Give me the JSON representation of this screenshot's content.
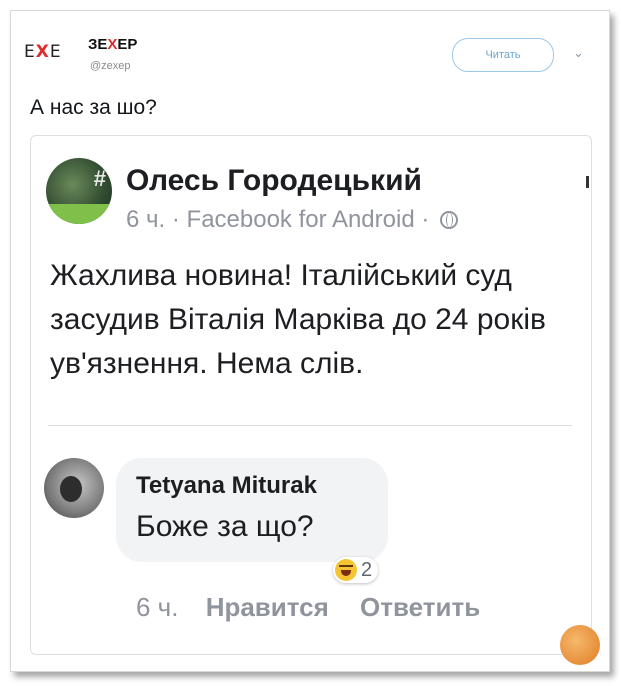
{
  "tweet": {
    "logo_left": "E",
    "logo_x": "X",
    "logo_right": "E",
    "account_name_prefix": "ЗЕ",
    "account_name_x": "X",
    "account_name_suffix": "ЕР",
    "handle": "@zexep",
    "follow_label": "Читать",
    "text": "А нас за шо?"
  },
  "post": {
    "author": "Олесь Городецький",
    "time": "6 ч.",
    "separator": "·",
    "source": "Facebook for Android",
    "body": "Жахлива новина! Італійський суд засудив Віталія Марківа до 24 років ув'язнення. Нема слів."
  },
  "comment": {
    "author": "Tetyana Miturak",
    "text": "Боже за що?",
    "reaction_count": "2",
    "time": "6 ч.",
    "like_label": "Нравится",
    "reply_label": "Ответить"
  },
  "colors": {
    "accent_red": "#e02b2b",
    "follow_blue": "#6aa6d6",
    "meta_gray": "#90949c"
  },
  "icons": [
    "globe-icon",
    "haha-reaction-icon",
    "chevron-down-icon"
  ]
}
